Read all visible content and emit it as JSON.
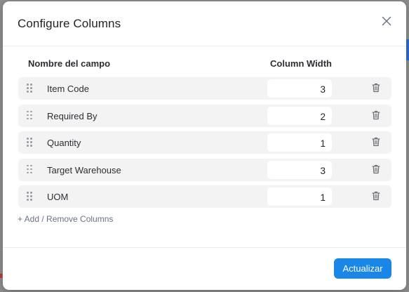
{
  "modal": {
    "title": "Configure Columns",
    "close_icon": "close-icon"
  },
  "table": {
    "headers": {
      "field_name": "Nombre del campo",
      "column_width": "Column Width"
    },
    "rows": [
      {
        "label": "Item Code",
        "width": "3"
      },
      {
        "label": "Required By",
        "width": "2"
      },
      {
        "label": "Quantity",
        "width": "1"
      },
      {
        "label": "Target Warehouse",
        "width": "3"
      },
      {
        "label": "UOM",
        "width": "1"
      }
    ],
    "row_icons": {
      "drag": "drag-handle-icon",
      "delete": "trash-icon"
    }
  },
  "actions": {
    "add_remove_label": "+ Add / Remove Columns",
    "update_label": "Actualizar"
  },
  "colors": {
    "primary": "#1a86e8",
    "row_background": "#f3f3f4",
    "overlay": "#8d8d8d"
  }
}
